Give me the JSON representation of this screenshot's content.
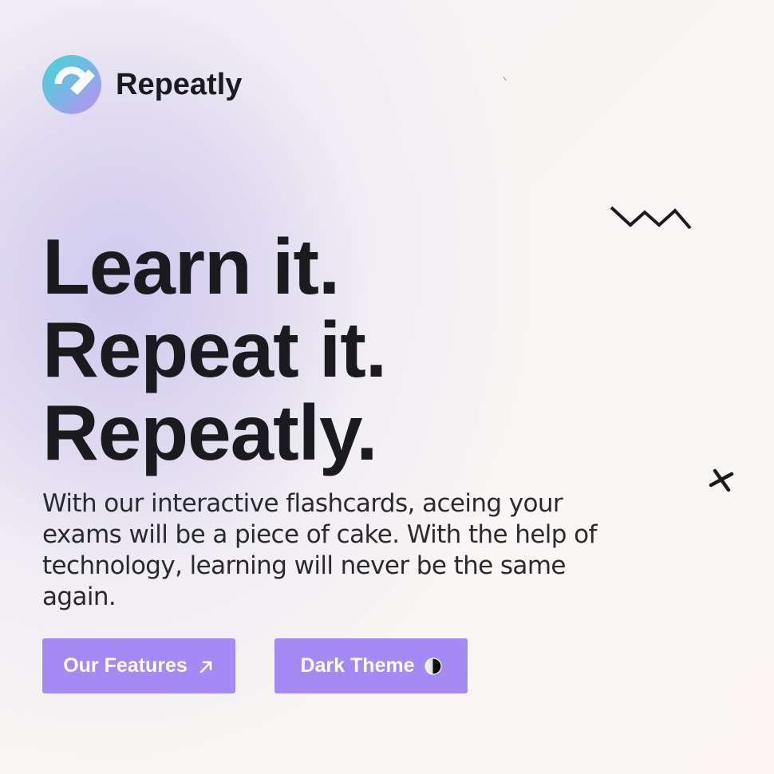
{
  "brand": {
    "name": "Repeatly",
    "logo_icon": "repeatly-logo-icon"
  },
  "hero": {
    "title_lines": [
      "Learn it.",
      "Repeat it.",
      "Repeatly."
    ],
    "description": "With our interactive flashcards, aceing your exams will be a piece of cake. With the help of technology, learning will never be the same again."
  },
  "actions": {
    "features": {
      "label": "Our Features",
      "icon": "arrow-up-right-icon"
    },
    "dark_theme": {
      "label": "Dark Theme",
      "icon": "half-circle-contrast-icon"
    }
  },
  "decorations": [
    "zigzag-icon",
    "cross-icon"
  ],
  "colors": {
    "accent": "#a58af5",
    "text": "#1b1b1f",
    "logo_gradient": [
      "#3ed9d2",
      "#c48df0"
    ]
  }
}
